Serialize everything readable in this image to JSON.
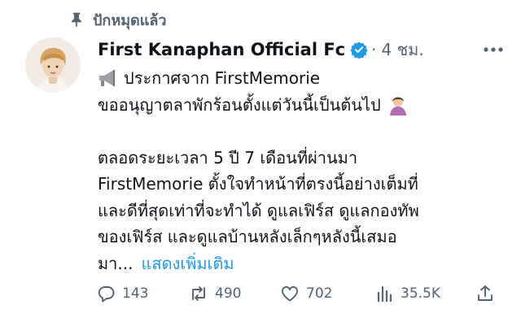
{
  "pinned": {
    "label": "ปักหมุดแล้ว"
  },
  "tweet": {
    "author": "First Kanaphan Official Fc",
    "separator": "·",
    "time": "4 ชม.",
    "lines": [
      "ประกาศจาก FirstMemorie",
      "ขออนุญาตลาพักร้อนตั้งแต่วันนี้เป็นต้นไป",
      "",
      "ตลอดระยะเวลา 5 ปี 7 เดือนที่ผ่านมา",
      "FirstMemorie ตั้งใจทำหน้าที่ตรงนี้อย่างเต็มที่",
      "และดีที่สุดเท่าที่จะทำได้ ดูแลเฟิร์ส ดูแลกองทัพ",
      "ของเฟิร์ส และดูแลบ้านหลังเล็กๆหลังนี้เสมอ",
      "มา..."
    ],
    "show_more": "แสดงเพิ่มเติม"
  },
  "actions": {
    "replies": "143",
    "reposts": "490",
    "likes": "702",
    "views": "35.5K"
  },
  "colors": {
    "accent": "#1d9bf0",
    "secondary_text": "#536471",
    "verified": "#1d9bf0"
  },
  "icons": [
    "pin-icon",
    "megaphone-icon",
    "person-bowing-icon",
    "reply-icon",
    "repost-icon",
    "like-icon",
    "views-icon",
    "share-icon",
    "verified-badge-icon",
    "more-options-icon"
  ]
}
